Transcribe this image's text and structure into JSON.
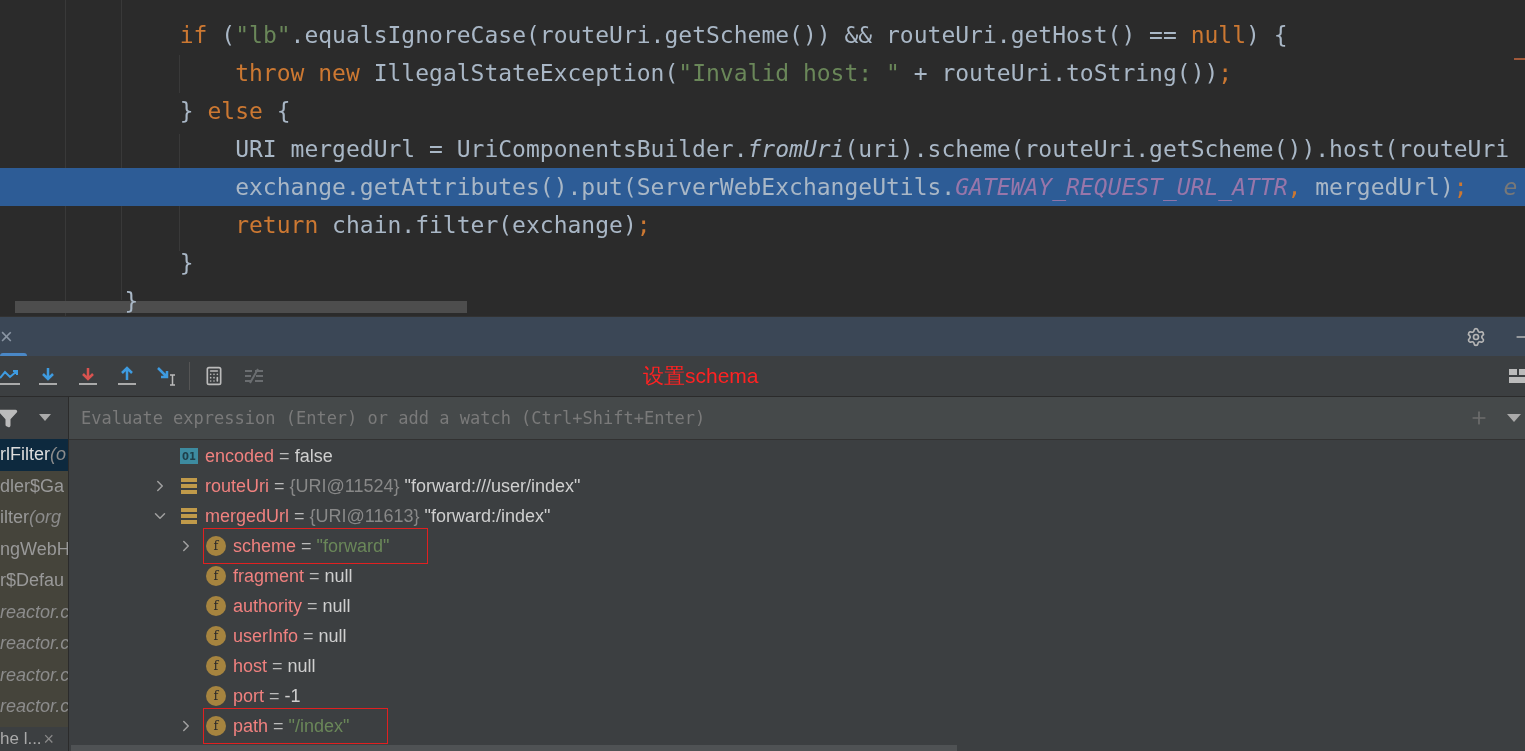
{
  "editor": {
    "lines": [
      {
        "current": false,
        "tokens": [
          {
            "kind": "keyword",
            "text": "        if"
          },
          {
            "kind": "plain",
            "text": " ("
          },
          {
            "kind": "string",
            "text": "\"lb\""
          },
          {
            "kind": "plain",
            "text": ".equalsIgnoreCase(routeUri.getScheme()) && routeUri.getHost() == "
          },
          {
            "kind": "keyword",
            "text": "null"
          },
          {
            "kind": "plain",
            "text": ") {"
          }
        ]
      },
      {
        "current": false,
        "tokens": [
          {
            "kind": "keyword",
            "text": "            throw new"
          },
          {
            "kind": "plain",
            "text": " IllegalStateException("
          },
          {
            "kind": "string",
            "text": "\"Invalid host: \""
          },
          {
            "kind": "plain",
            "text": " + routeUri.toString())"
          },
          {
            "kind": "keyword",
            "text": ";"
          }
        ]
      },
      {
        "current": false,
        "tokens": [
          {
            "kind": "plain",
            "text": "        }"
          },
          {
            "kind": "keyword",
            "text": " else"
          },
          {
            "kind": "plain",
            "text": " {"
          }
        ]
      },
      {
        "current": false,
        "tokens": [
          {
            "kind": "plain",
            "text": "            URI mergedUrl = UriComponentsBuilder."
          },
          {
            "kind": "method",
            "text": "fromUri"
          },
          {
            "kind": "plain",
            "text": "(uri).scheme(routeUri.getScheme()).host(routeUri"
          }
        ]
      },
      {
        "current": true,
        "tokens": [
          {
            "kind": "plain",
            "text": "            exchange.getAttributes().put(ServerWebExchangeUtils."
          },
          {
            "kind": "constant",
            "text": "GATEWAY_REQUEST_URL_ATTR"
          },
          {
            "kind": "keyword",
            "text": ","
          },
          {
            "kind": "plain",
            "text": " mergedUrl)"
          },
          {
            "kind": "keyword",
            "text": ";"
          },
          {
            "kind": "hint",
            "text": "e"
          }
        ]
      },
      {
        "current": false,
        "tokens": [
          {
            "kind": "keyword",
            "text": "            return"
          },
          {
            "kind": "plain",
            "text": " chain.filter(exchange)"
          },
          {
            "kind": "keyword",
            "text": ";"
          }
        ]
      },
      {
        "current": false,
        "tokens": [
          {
            "kind": "plain",
            "text": "        }"
          }
        ]
      },
      {
        "current": false,
        "tokens": [
          {
            "kind": "plain",
            "text": "    }"
          }
        ]
      }
    ]
  },
  "debug": {
    "close": "×",
    "annotation": "设置schema",
    "eval": {
      "placeholder": "Evaluate expression (Enter) or add a watch (Ctrl+Shift+Enter)"
    },
    "frames": [
      {
        "text": "rlFilter ",
        "detail": "(o",
        "library": false,
        "selected": true
      },
      {
        "text": "dler$Ga",
        "library": false,
        "selected": false
      },
      {
        "text": "ilter ",
        "detail": "(org",
        "library": false,
        "selected": false
      },
      {
        "text": "ngWebH",
        "library": false,
        "selected": false
      },
      {
        "text": "r$Defau",
        "library": false,
        "selected": false
      },
      {
        "text": "reactor.c",
        "library": true,
        "selected": false
      },
      {
        "text": "reactor.c",
        "library": true,
        "selected": false
      },
      {
        "text": "reactor.c",
        "library": true,
        "selected": false
      },
      {
        "text": "reactor.c",
        "library": true,
        "selected": false
      }
    ],
    "bottom_tab": {
      "label": "he l...",
      "close": "×"
    },
    "variables": [
      {
        "kind": "primitive",
        "badge": "01",
        "name": "encoded",
        "operator": "=",
        "value": "false",
        "is_string": false,
        "boxed": false
      },
      {
        "kind": "object",
        "name": "routeUri",
        "operator": "=",
        "ref": "{URI@11524}",
        "value": "\"forward:///user/index\"",
        "is_string": false,
        "expanded": false,
        "boxed": false
      },
      {
        "kind": "object",
        "name": "mergedUrl",
        "operator": "=",
        "ref": "{URI@11613}",
        "value": "\"forward:/index\"",
        "is_string": false,
        "expanded": true,
        "boxed": false,
        "children": [
          {
            "kind": "field",
            "badge": "f",
            "name": "scheme",
            "operator": "=",
            "value": "\"forward\"",
            "is_string": true,
            "expanded": false,
            "boxed": true
          },
          {
            "kind": "field",
            "badge": "f",
            "name": "fragment",
            "operator": "=",
            "value": "null",
            "is_string": false,
            "boxed": false
          },
          {
            "kind": "field",
            "badge": "f",
            "name": "authority",
            "operator": "=",
            "value": "null",
            "is_string": false,
            "boxed": false
          },
          {
            "kind": "field",
            "badge": "f",
            "name": "userInfo",
            "operator": "=",
            "value": "null",
            "is_string": false,
            "boxed": false
          },
          {
            "kind": "field",
            "badge": "f",
            "name": "host",
            "operator": "=",
            "value": "null",
            "is_string": false,
            "boxed": false
          },
          {
            "kind": "field",
            "badge": "f",
            "name": "port",
            "operator": "=",
            "value": "-1",
            "is_string": false,
            "boxed": false
          },
          {
            "kind": "field",
            "badge": "f",
            "name": "path",
            "operator": "=",
            "value": "\"/index\"",
            "is_string": true,
            "expanded": false,
            "boxed": true
          }
        ]
      }
    ]
  }
}
